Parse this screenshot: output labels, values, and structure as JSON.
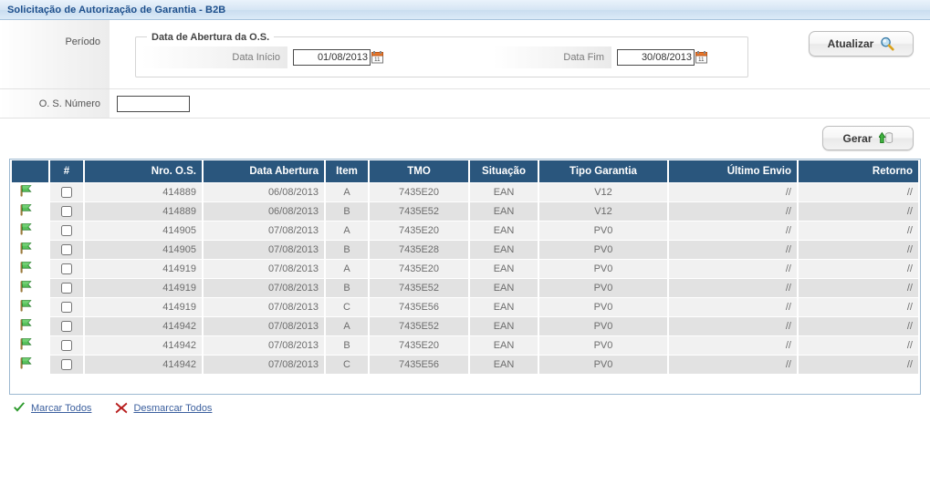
{
  "window": {
    "title": "Solicitação de Autorização de Garantia - B2B"
  },
  "filters": {
    "periodo_label": "Período",
    "fieldset_legend": "Data de Abertura da O.S.",
    "data_inicio_label": "Data Início",
    "data_inicio_value": "01/08/2013",
    "data_fim_label": "Data Fim",
    "data_fim_value": "30/08/2013",
    "os_numero_label": "O. S. Número",
    "os_numero_value": "",
    "os_numero_placeholder": ""
  },
  "toolbar": {
    "atualizar_label": "Atualizar",
    "atualizar_icon": "magnifier-icon",
    "gerar_label": "Gerar",
    "gerar_icon": "upload-database-icon"
  },
  "table": {
    "columns": [
      {
        "key": "flag",
        "label": ""
      },
      {
        "key": "chk",
        "label": "#"
      },
      {
        "key": "nro",
        "label": "Nro. O.S."
      },
      {
        "key": "data",
        "label": "Data Abertura"
      },
      {
        "key": "item",
        "label": "Item"
      },
      {
        "key": "tmo",
        "label": "TMO"
      },
      {
        "key": "sit",
        "label": "Situação"
      },
      {
        "key": "tipo",
        "label": "Tipo Garantia"
      },
      {
        "key": "env",
        "label": "Último Envio"
      },
      {
        "key": "ret",
        "label": "Retorno"
      }
    ],
    "row_icon": "green-flag-icon",
    "rows": [
      {
        "nro": "414889",
        "data": "06/08/2013",
        "item": "A",
        "tmo": "7435E20",
        "sit": "EAN",
        "tipo": "V12",
        "env": "//",
        "ret": "//",
        "checked": false
      },
      {
        "nro": "414889",
        "data": "06/08/2013",
        "item": "B",
        "tmo": "7435E52",
        "sit": "EAN",
        "tipo": "V12",
        "env": "//",
        "ret": "//",
        "checked": false
      },
      {
        "nro": "414905",
        "data": "07/08/2013",
        "item": "A",
        "tmo": "7435E20",
        "sit": "EAN",
        "tipo": "PV0",
        "env": "//",
        "ret": "//",
        "checked": false
      },
      {
        "nro": "414905",
        "data": "07/08/2013",
        "item": "B",
        "tmo": "7435E28",
        "sit": "EAN",
        "tipo": "PV0",
        "env": "//",
        "ret": "//",
        "checked": false
      },
      {
        "nro": "414919",
        "data": "07/08/2013",
        "item": "A",
        "tmo": "7435E20",
        "sit": "EAN",
        "tipo": "PV0",
        "env": "//",
        "ret": "//",
        "checked": false
      },
      {
        "nro": "414919",
        "data": "07/08/2013",
        "item": "B",
        "tmo": "7435E52",
        "sit": "EAN",
        "tipo": "PV0",
        "env": "//",
        "ret": "//",
        "checked": false
      },
      {
        "nro": "414919",
        "data": "07/08/2013",
        "item": "C",
        "tmo": "7435E56",
        "sit": "EAN",
        "tipo": "PV0",
        "env": "//",
        "ret": "//",
        "checked": false
      },
      {
        "nro": "414942",
        "data": "07/08/2013",
        "item": "A",
        "tmo": "7435E52",
        "sit": "EAN",
        "tipo": "PV0",
        "env": "//",
        "ret": "//",
        "checked": false
      },
      {
        "nro": "414942",
        "data": "07/08/2013",
        "item": "B",
        "tmo": "7435E20",
        "sit": "EAN",
        "tipo": "PV0",
        "env": "//",
        "ret": "//",
        "checked": false
      },
      {
        "nro": "414942",
        "data": "07/08/2013",
        "item": "C",
        "tmo": "7435E56",
        "sit": "EAN",
        "tipo": "PV0",
        "env": "//",
        "ret": "//",
        "checked": false
      }
    ]
  },
  "footer": {
    "marcar_todos_label": "Marcar Todos",
    "marcar_todos_icon": "green-check-icon",
    "desmarcar_todos_label": "Desmarcar Todos",
    "desmarcar_todos_icon": "red-x-icon"
  },
  "colors": {
    "title_text": "#1d4f8c",
    "title_bar": "#d5e5f4",
    "table_header": "#2a567d",
    "table_border": "#9db9d1",
    "row_odd": "#f1f1f1",
    "row_even": "#e2e2e2",
    "link": "#3b5f9e",
    "check_green": "#2d9a2d",
    "x_red": "#b81f1f"
  }
}
